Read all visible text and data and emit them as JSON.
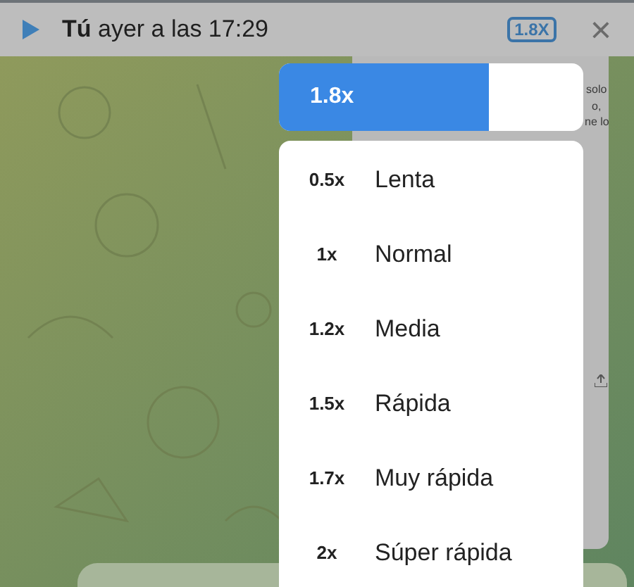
{
  "header": {
    "sender": "Tú",
    "time_text": " ayer a las 17:29",
    "speed_badge": "1.8X",
    "close": "×"
  },
  "chat": {
    "document_lines": [
      "solo",
      "o,",
      "ne lo"
    ]
  },
  "speed_slider": {
    "value": "1.8x",
    "level": 0.69
  },
  "speed_menu": [
    {
      "speed": "0.5x",
      "label": "Lenta"
    },
    {
      "speed": "1x",
      "label": "Normal"
    },
    {
      "speed": "1.2x",
      "label": "Media"
    },
    {
      "speed": "1.5x",
      "label": "Rápida"
    },
    {
      "speed": "1.7x",
      "label": "Muy rápida"
    },
    {
      "speed": "2x",
      "label": "Súper rápida"
    }
  ]
}
